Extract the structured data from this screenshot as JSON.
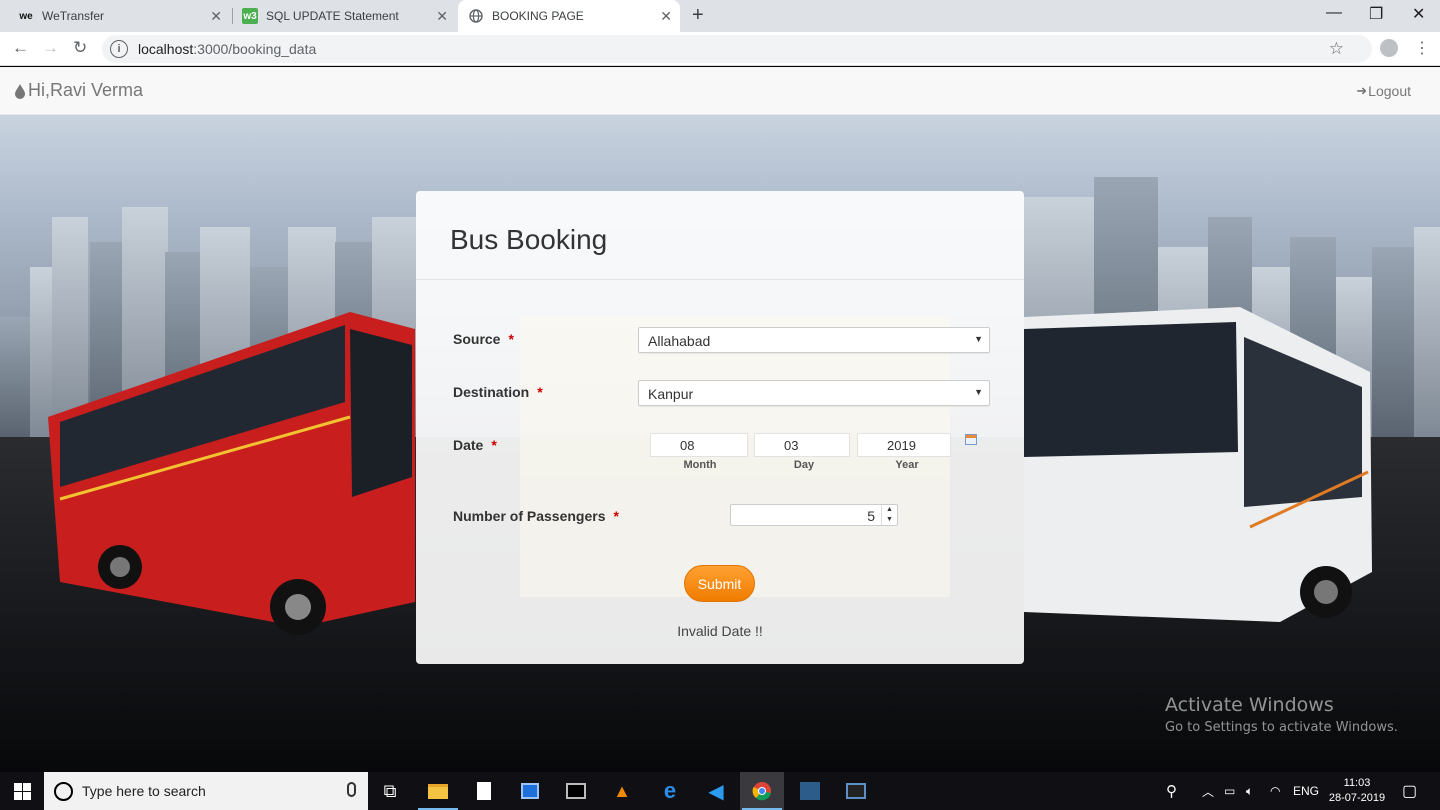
{
  "browser": {
    "tabs": [
      {
        "label": "WeTransfer",
        "icon": "wetransfer-icon"
      },
      {
        "label": "SQL UPDATE Statement",
        "icon": "w3schools-icon"
      },
      {
        "label": "BOOKING PAGE",
        "icon": "globe-icon"
      }
    ],
    "url_host": "localhost",
    "url_path": ":3000/booking_data"
  },
  "navbar": {
    "greeting": "Hi,Ravi Verma",
    "logout": "Logout"
  },
  "form": {
    "title": "Bus Booking",
    "required_mark": "*",
    "source": {
      "label": "Source",
      "value": "Allahabad"
    },
    "destination": {
      "label": "Destination",
      "value": "Kanpur"
    },
    "date": {
      "label": "Date",
      "month": "08",
      "day": "03",
      "year": "2019",
      "month_caption": "Month",
      "day_caption": "Day",
      "year_caption": "Year"
    },
    "passengers": {
      "label": "Number of Passengers",
      "value": "5"
    },
    "submit": "Submit",
    "message": "Invalid Date !!"
  },
  "watermark": {
    "title": "Activate Windows",
    "subtitle": "Go to Settings to activate Windows."
  },
  "taskbar": {
    "search_placeholder": "Type here to search",
    "language": "ENG",
    "time": "11:03",
    "date": "28-07-2019"
  },
  "colors": {
    "accent_orange": "#f28a0a",
    "required_red": "#cc0000"
  }
}
